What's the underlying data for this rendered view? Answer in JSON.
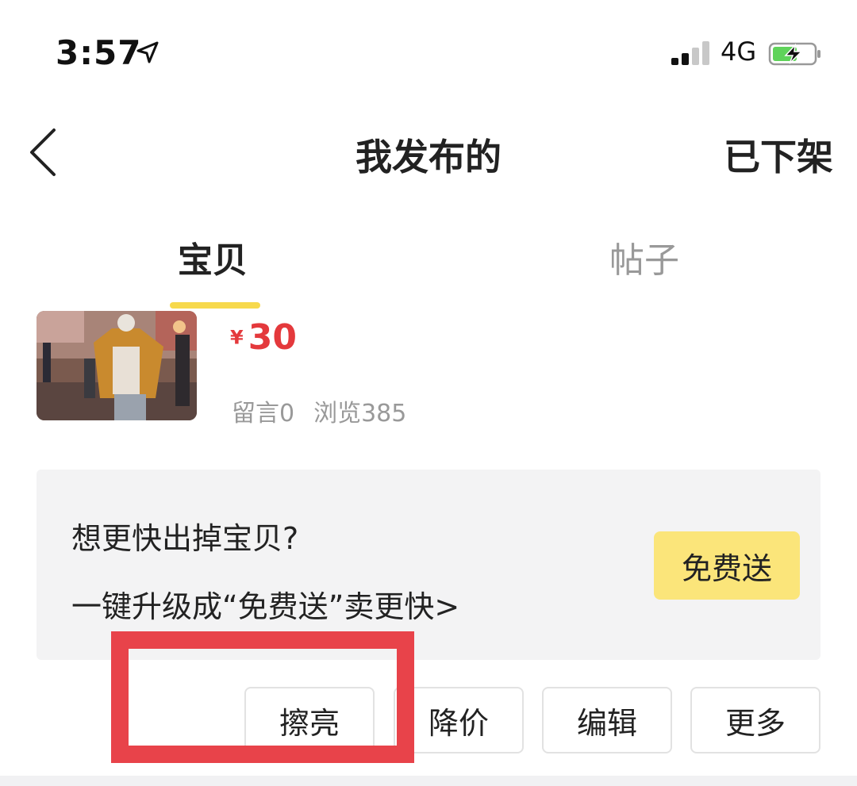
{
  "status_bar": {
    "time": "3:57",
    "location_icon": "location-arrow-icon",
    "signal_icon": "cellular-signal-icon",
    "network": "4G",
    "battery_icon": "battery-charging-icon"
  },
  "nav": {
    "back_icon": "chevron-left-icon",
    "title": "我发布的",
    "right_label": "已下架"
  },
  "tabs": [
    {
      "label": "宝贝",
      "active": true
    },
    {
      "label": "帖子",
      "active": false
    }
  ],
  "item": {
    "currency": "¥",
    "price": "30",
    "comments": "留言0",
    "views": "浏览385"
  },
  "promo": {
    "line1": "想更快出掉宝贝?",
    "line2": "一键升级成“免费送”卖更快>",
    "button_label": "免费送"
  },
  "actions": [
    {
      "label": "擦亮"
    },
    {
      "label": "降价"
    },
    {
      "label": "编辑"
    },
    {
      "label": "更多"
    }
  ],
  "colors": {
    "accent_yellow": "#f7d94c",
    "button_yellow": "#fbe57a",
    "price_red": "#e4393c",
    "highlight_red": "#e8434a",
    "muted_text": "#999999"
  }
}
